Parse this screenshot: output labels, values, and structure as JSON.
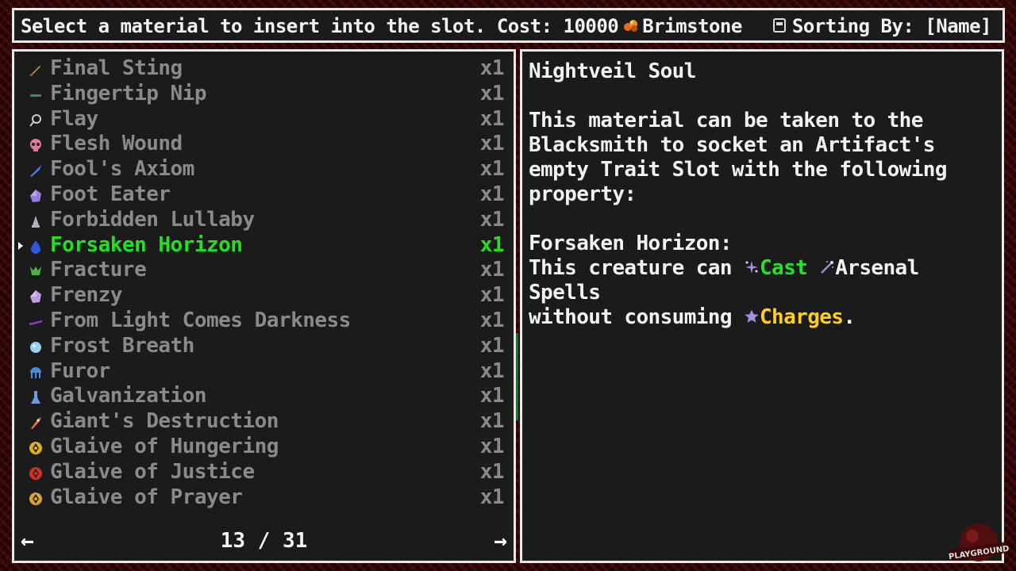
{
  "header": {
    "prompt": "Select a material to insert into the slot. Cost: 10000",
    "currency": "Brimstone",
    "sort_label": "Sorting By: [Name]"
  },
  "list": {
    "items": [
      {
        "name": "Final Sting",
        "qty": "x1",
        "icon": "dagger-icon",
        "color": "#d9a83a"
      },
      {
        "name": "Fingertip Nip",
        "qty": "x1",
        "icon": "fang-icon",
        "color": "#3a8a7a"
      },
      {
        "name": "Flay",
        "qty": "x1",
        "icon": "magnifier-icon",
        "color": "#cccccc"
      },
      {
        "name": "Flesh Wound",
        "qty": "x1",
        "icon": "skull-icon",
        "color": "#e07a9a"
      },
      {
        "name": "Fool's Axiom",
        "qty": "x1",
        "icon": "blade-icon",
        "color": "#4a7ae0"
      },
      {
        "name": "Foot Eater",
        "qty": "x1",
        "icon": "crystal-icon",
        "color": "#9a7ae0"
      },
      {
        "name": "Forbidden Lullaby",
        "qty": "x1",
        "icon": "bell-icon",
        "color": "#b0b0c0"
      },
      {
        "name": "Forsaken Horizon",
        "qty": "x1",
        "icon": "water-drop-icon",
        "color": "#2a5ae0",
        "selected": true
      },
      {
        "name": "Fracture",
        "qty": "x1",
        "icon": "claw-icon",
        "color": "#4ab04a"
      },
      {
        "name": "Frenzy",
        "qty": "x1",
        "icon": "crystal-icon",
        "color": "#c09ae0"
      },
      {
        "name": "From Light Comes Darkness",
        "qty": "x1",
        "icon": "wand-icon",
        "color": "#8a3ac0"
      },
      {
        "name": "Frost Breath",
        "qty": "x1",
        "icon": "snowflake-icon",
        "color": "#9ad0e8"
      },
      {
        "name": "Furor",
        "qty": "x1",
        "icon": "jellyfish-icon",
        "color": "#4a8ae0"
      },
      {
        "name": "Galvanization",
        "qty": "x1",
        "icon": "flask-icon",
        "color": "#6a9ae0"
      },
      {
        "name": "Giant's Destruction",
        "qty": "x1",
        "icon": "rocket-icon",
        "color": "#e07030"
      },
      {
        "name": "Glaive of Hungering",
        "qty": "x1",
        "icon": "glaive-icon",
        "color": "#e0b020"
      },
      {
        "name": "Glaive of Justice",
        "qty": "x1",
        "icon": "glaive-icon",
        "color": "#d03020"
      },
      {
        "name": "Glaive of Prayer",
        "qty": "x1",
        "icon": "glaive-icon",
        "color": "#e0a030"
      }
    ]
  },
  "pager": {
    "prev_label": "←",
    "next_label": "→",
    "page": "13 / 31"
  },
  "detail": {
    "title": "Nightveil Soul",
    "description": "This material can be taken to the Blacksmith to socket an Artifact's empty Trait Slot with the following property:",
    "property_name": "Forsaken Horizon:",
    "prop_text1": "This creature can",
    "prop_cast": "Cast",
    "prop_text2": "Arsenal Spells",
    "prop_text3": "without consuming",
    "prop_charges": "Charges",
    "prop_end": "."
  },
  "colors": {
    "selected": "#22e022",
    "keyword_green": "#27e027",
    "keyword_yellow": "#ffcf1a",
    "unselected": "#8a8a8a"
  },
  "watermark": {
    "text": "PLAYGROUND"
  }
}
